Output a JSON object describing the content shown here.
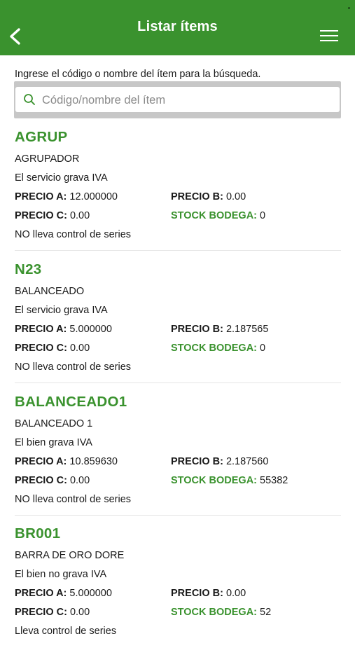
{
  "header": {
    "title": "Listar ítems",
    "back_icon": "chevron-left-icon",
    "menu_icon": "hamburger-menu-icon",
    "color": "#3a922e"
  },
  "search": {
    "instruction": "Ingrese el código o nombre del ítem para la búsqueda.",
    "placeholder": "Código/nombre del ítem",
    "value": ""
  },
  "labels": {
    "precio_a": "PRECIO A:",
    "precio_b": "PRECIO B:",
    "precio_c": "PRECIO C:",
    "stock": "STOCK BODEGA:"
  },
  "items": [
    {
      "code": "AGRUP",
      "name": "AGRUPADOR",
      "tax": "El servicio grava IVA",
      "precio_a": "12.000000",
      "precio_b": "0.00",
      "precio_c": "0.00",
      "stock": "0",
      "series": "NO lleva control de series"
    },
    {
      "code": "N23",
      "name": "BALANCEADO",
      "tax": "El servicio grava IVA",
      "precio_a": "5.000000",
      "precio_b": "2.187565",
      "precio_c": "0.00",
      "stock": "0",
      "series": "NO lleva control de series"
    },
    {
      "code": "BALANCEADO1",
      "name": "BALANCEADO 1",
      "tax": "El bien grava IVA",
      "precio_a": "10.859630",
      "precio_b": "2.187560",
      "precio_c": "0.00",
      "stock": "55382",
      "series": "NO lleva control de series"
    },
    {
      "code": "BR001",
      "name": "BARRA DE ORO DORE",
      "tax": "El bien no grava IVA",
      "precio_a": "5.000000",
      "precio_b": "0.00",
      "precio_c": "0.00",
      "stock": "52",
      "series": "Lleva control de series"
    }
  ]
}
